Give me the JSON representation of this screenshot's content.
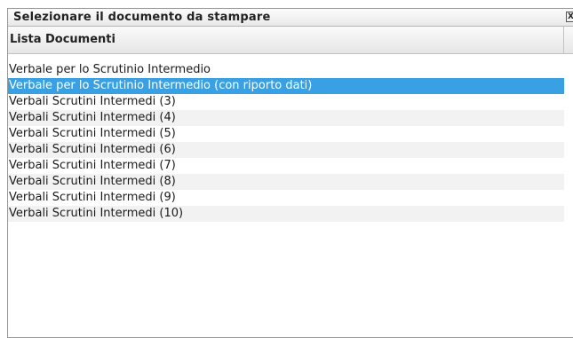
{
  "dialog": {
    "title": "Selezionare il documento da stampare",
    "close_glyph": "X"
  },
  "list": {
    "column_header": "Lista Documenti",
    "selected_index": 1,
    "items": [
      "Verbale per lo Scrutinio Intermedio",
      "Verbale per lo Scrutinio Intermedio (con riporto dati)",
      "Verbali Scrutini Intermedi (3)",
      "Verbali Scrutini Intermedi (4)",
      "Verbali Scrutini Intermedi (5)",
      "Verbali Scrutini Intermedi (6)",
      "Verbali Scrutini Intermedi (7)",
      "Verbali Scrutini Intermedi (8)",
      "Verbali Scrutini Intermedi (9)",
      "Verbali Scrutini Intermedi (10)"
    ]
  },
  "colors": {
    "selection": "#39a0e4",
    "alt_row": "#f2f2f2"
  }
}
